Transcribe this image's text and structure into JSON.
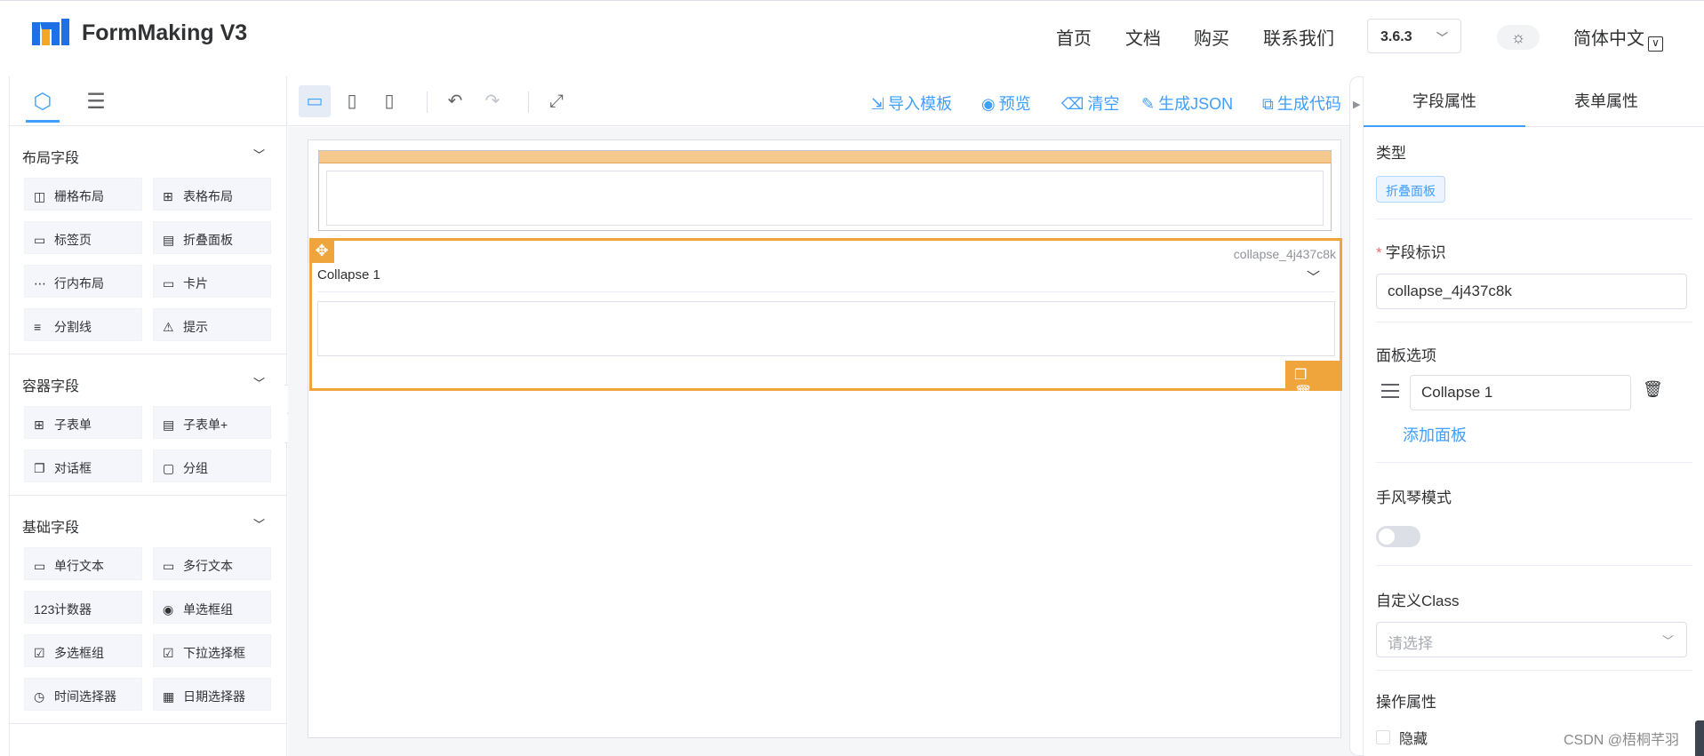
{
  "header": {
    "brand": "FormMaking V3",
    "nav": [
      "首页",
      "文档",
      "购买",
      "联系我们"
    ],
    "version": "3.6.3",
    "language": "简体中文"
  },
  "left_panel": {
    "sections": [
      {
        "title": "布局字段",
        "items": [
          {
            "icon": "grid-layout-icon",
            "glyph": "◫",
            "label": "栅格布局"
          },
          {
            "icon": "table-layout-icon",
            "glyph": "⊞",
            "label": "表格布局"
          },
          {
            "icon": "tabs-icon",
            "glyph": "▭",
            "label": "标签页"
          },
          {
            "icon": "collapse-icon",
            "glyph": "▤",
            "label": "折叠面板"
          },
          {
            "icon": "inline-layout-icon",
            "glyph": "⋯",
            "label": "行内布局"
          },
          {
            "icon": "card-icon",
            "glyph": "▭",
            "label": "卡片"
          },
          {
            "icon": "divider-icon",
            "glyph": "≡",
            "label": "分割线"
          },
          {
            "icon": "alert-icon",
            "glyph": "⚠",
            "label": "提示"
          }
        ]
      },
      {
        "title": "容器字段",
        "items": [
          {
            "icon": "subform-icon",
            "glyph": "⊞",
            "label": "子表单"
          },
          {
            "icon": "subform-plus-icon",
            "glyph": "▤",
            "label": "子表单+"
          },
          {
            "icon": "dialog-icon",
            "glyph": "❐",
            "label": "对话框"
          },
          {
            "icon": "group-icon",
            "glyph": "▢",
            "label": "分组"
          }
        ]
      },
      {
        "title": "基础字段",
        "items": [
          {
            "icon": "input-icon",
            "glyph": "▭",
            "label": "单行文本"
          },
          {
            "icon": "textarea-icon",
            "glyph": "▭",
            "label": "多行文本"
          },
          {
            "icon": "number-icon",
            "glyph": "123",
            "label": "计数器"
          },
          {
            "icon": "radio-icon",
            "glyph": "◉",
            "label": "单选框组"
          },
          {
            "icon": "checkbox-icon",
            "glyph": "☑",
            "label": "多选框组"
          },
          {
            "icon": "select-icon",
            "glyph": "☑",
            "label": "下拉选择框"
          },
          {
            "icon": "time-icon",
            "glyph": "◷",
            "label": "时间选择器"
          },
          {
            "icon": "date-icon",
            "glyph": "▦",
            "label": "日期选择器"
          }
        ]
      }
    ]
  },
  "toolbar": {
    "actions": [
      {
        "icon": "import-icon",
        "glyph": "⇲",
        "label": "导入模板"
      },
      {
        "icon": "preview-icon",
        "glyph": "◉",
        "label": "预览"
      },
      {
        "icon": "clear-icon",
        "glyph": "⌫",
        "label": "清空"
      },
      {
        "icon": "json-icon",
        "glyph": "✎",
        "label": "生成JSON"
      },
      {
        "icon": "code-icon",
        "glyph": "⧉",
        "label": "生成代码"
      }
    ]
  },
  "canvas": {
    "selected_id": "collapse_4j437c8k",
    "collapse_title": "Collapse 1"
  },
  "right_panel": {
    "tabs": [
      "字段属性",
      "表单属性"
    ],
    "type_label": "类型",
    "type_value": "折叠面板",
    "field_id_label": "字段标识",
    "field_id_value": "collapse_4j437c8k",
    "panel_options_label": "面板选项",
    "panel_option_value": "Collapse 1",
    "add_panel": "添加面板",
    "accordion_label": "手风琴模式",
    "custom_class_label": "自定义Class",
    "custom_class_placeholder": "请选择",
    "operation_label": "操作属性",
    "hide_label": "隐藏"
  },
  "watermark": "CSDN @梧桐芊羽",
  "colors": {
    "accent": "#409eff",
    "selection": "#f0a43c"
  }
}
